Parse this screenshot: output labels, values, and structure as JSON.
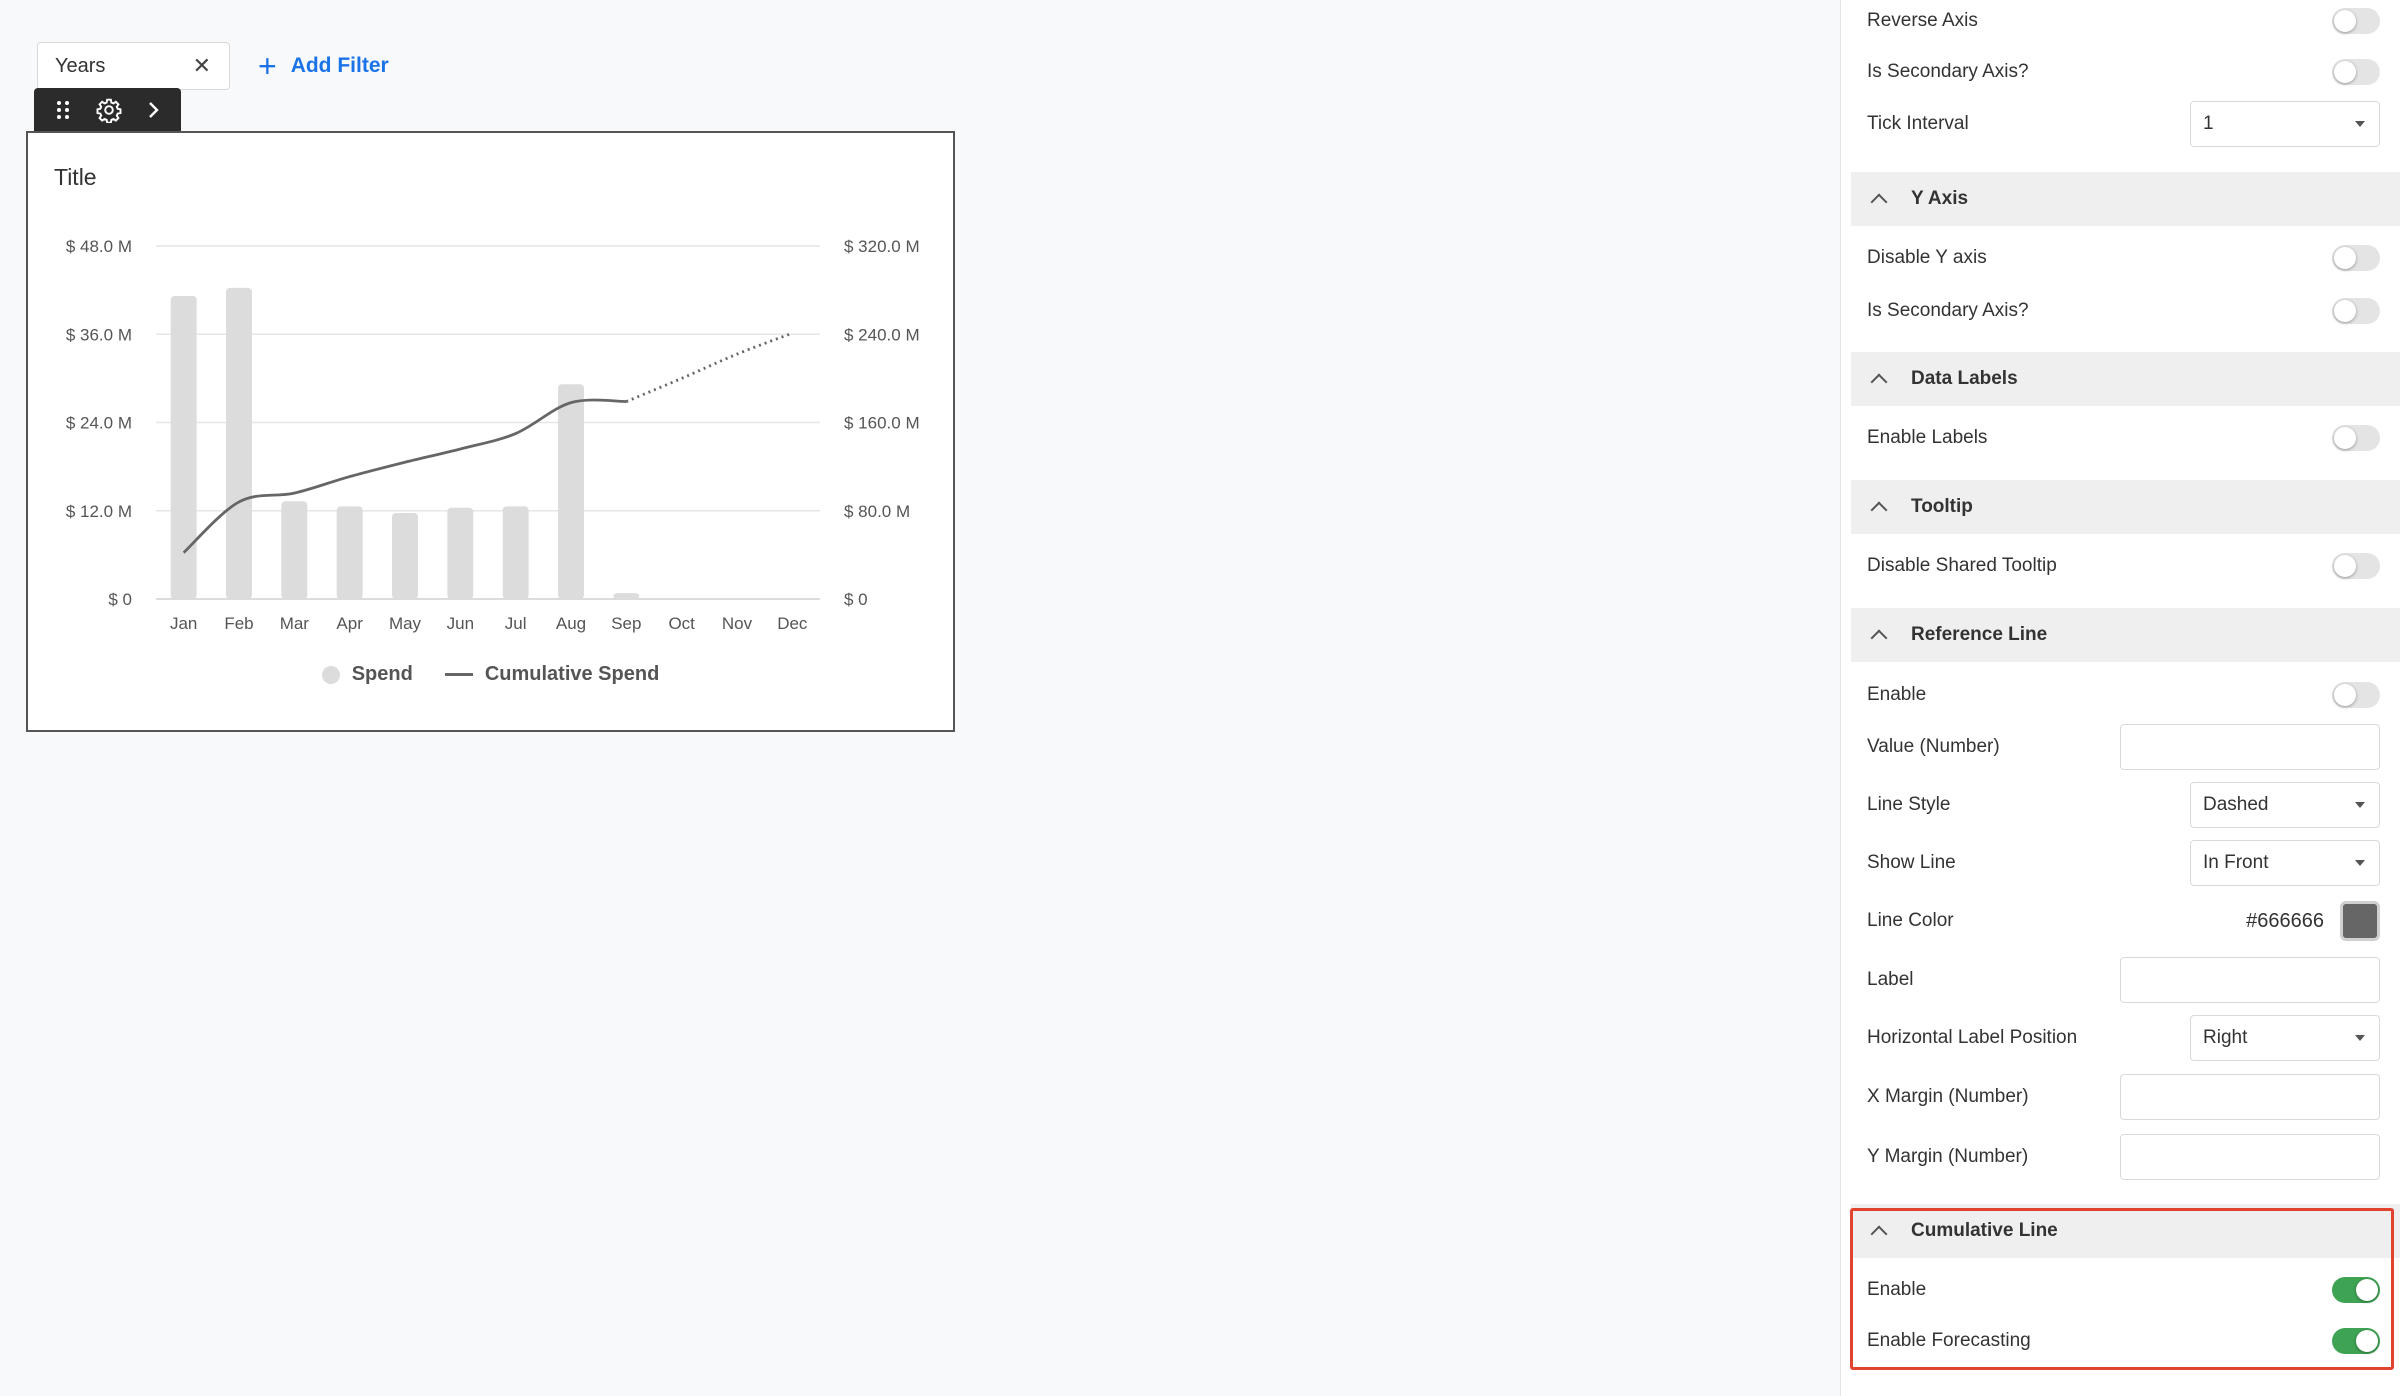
{
  "filter": {
    "chip_label": "Years",
    "add_label": "Add Filter"
  },
  "chart": {
    "title": "Title",
    "legend": [
      "Spend",
      "Cumulative Spend"
    ]
  },
  "chart_data": {
    "type": "bar",
    "title": "Title",
    "categories": [
      "Jan",
      "Feb",
      "Mar",
      "Apr",
      "May",
      "Jun",
      "Jul",
      "Aug",
      "Sep",
      "Oct",
      "Nov",
      "Dec"
    ],
    "left_axis": {
      "ticks": [
        "$ 0",
        "$ 12.0 M",
        "$ 24.0 M",
        "$ 36.0 M",
        "$ 48.0 M"
      ],
      "ylim": [
        0,
        48
      ]
    },
    "right_axis": {
      "ticks": [
        "$ 0",
        "$ 80.0 M",
        "$ 160.0 M",
        "$ 240.0 M",
        "$ 320.0 M"
      ],
      "ylim": [
        0,
        320
      ]
    },
    "series": [
      {
        "name": "Spend",
        "type": "bar",
        "axis": "left",
        "color": "#dcdcdc",
        "values": [
          41.2,
          42.3,
          13.3,
          12.6,
          11.7,
          12.4,
          12.6,
          29.2,
          0.8,
          0,
          0,
          0
        ]
      },
      {
        "name": "Cumulative Spend",
        "type": "line",
        "axis": "right",
        "color": "#666666",
        "values": [
          42,
          88,
          96,
          111,
          124,
          136,
          150,
          178,
          179,
          200,
          222,
          241
        ],
        "forecast_from_index": 8
      }
    ],
    "grid": true,
    "legend_position": "bottom-center"
  },
  "panel": {
    "rows_top": [
      {
        "label": "Reverse Axis",
        "toggle": false
      },
      {
        "label": "Is Secondary Axis?",
        "toggle": false
      }
    ],
    "tick_interval": {
      "label": "Tick Interval",
      "value": "1"
    },
    "y_axis": {
      "header": "Y Axis",
      "disable": {
        "label": "Disable Y axis",
        "toggle": false
      },
      "secondary": {
        "label": "Is Secondary Axis?",
        "toggle": false
      }
    },
    "data_labels": {
      "header": "Data Labels",
      "enable": {
        "label": "Enable Labels",
        "toggle": false
      }
    },
    "tooltip": {
      "header": "Tooltip",
      "disable": {
        "label": "Disable Shared Tooltip",
        "toggle": false
      }
    },
    "reference_line": {
      "header": "Reference Line",
      "enable": {
        "label": "Enable",
        "toggle": false
      },
      "value": {
        "label": "Value (Number)",
        "value": ""
      },
      "line_style": {
        "label": "Line Style",
        "value": "Dashed"
      },
      "show_line": {
        "label": "Show Line",
        "value": "In Front"
      },
      "line_color": {
        "label": "Line Color",
        "value": "#666666"
      },
      "label_field": {
        "label": "Label",
        "value": ""
      },
      "h_label_pos": {
        "label": "Horizontal Label Position",
        "value": "Right"
      },
      "x_margin": {
        "label": "X Margin (Number)",
        "value": ""
      },
      "y_margin": {
        "label": "Y Margin (Number)",
        "value": ""
      }
    },
    "cumulative_line": {
      "header": "Cumulative Line",
      "enable": {
        "label": "Enable",
        "toggle": true
      },
      "forecasting": {
        "label": "Enable Forecasting",
        "toggle": true
      }
    }
  },
  "colors": {
    "accent": "#1a73e8",
    "toggle_on": "#3fa354",
    "highlight": "#e2432f"
  }
}
